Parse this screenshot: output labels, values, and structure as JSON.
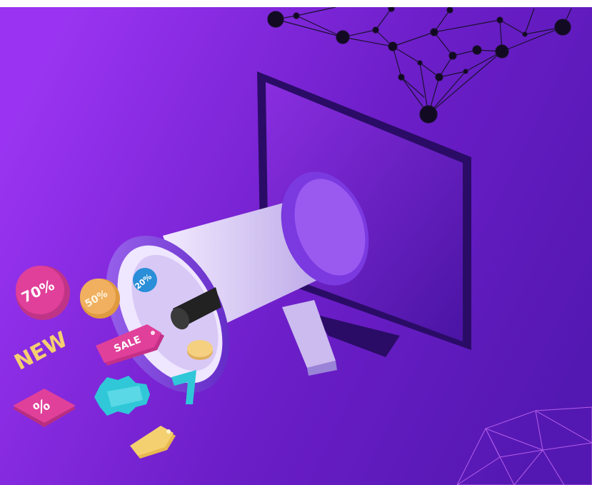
{
  "badges": {
    "seventy_percent": "70%",
    "fifty_percent": "50%",
    "twenty_percent": "20%",
    "new_label": "NEW",
    "sale_label": "SALE",
    "percent_sign": "%"
  },
  "colors": {
    "background_dark": "#5a1ab8",
    "background_light": "#9a3cf0",
    "megaphone_body": "#d8cdf2",
    "megaphone_rim": "#7a3ae0",
    "monitor_frame": "#3a1280",
    "monitor_screen": "#7a2ad8",
    "badge_pink": "#e0409a",
    "badge_orange": "#f0b060",
    "badge_teal": "#30c8d8",
    "badge_yellow": "#f4d070",
    "network_lines": "#1a1030"
  },
  "icons": [
    "network-graph-decoration",
    "geodesic-mesh-decoration",
    "megaphone-illustration",
    "monitor-illustration"
  ]
}
